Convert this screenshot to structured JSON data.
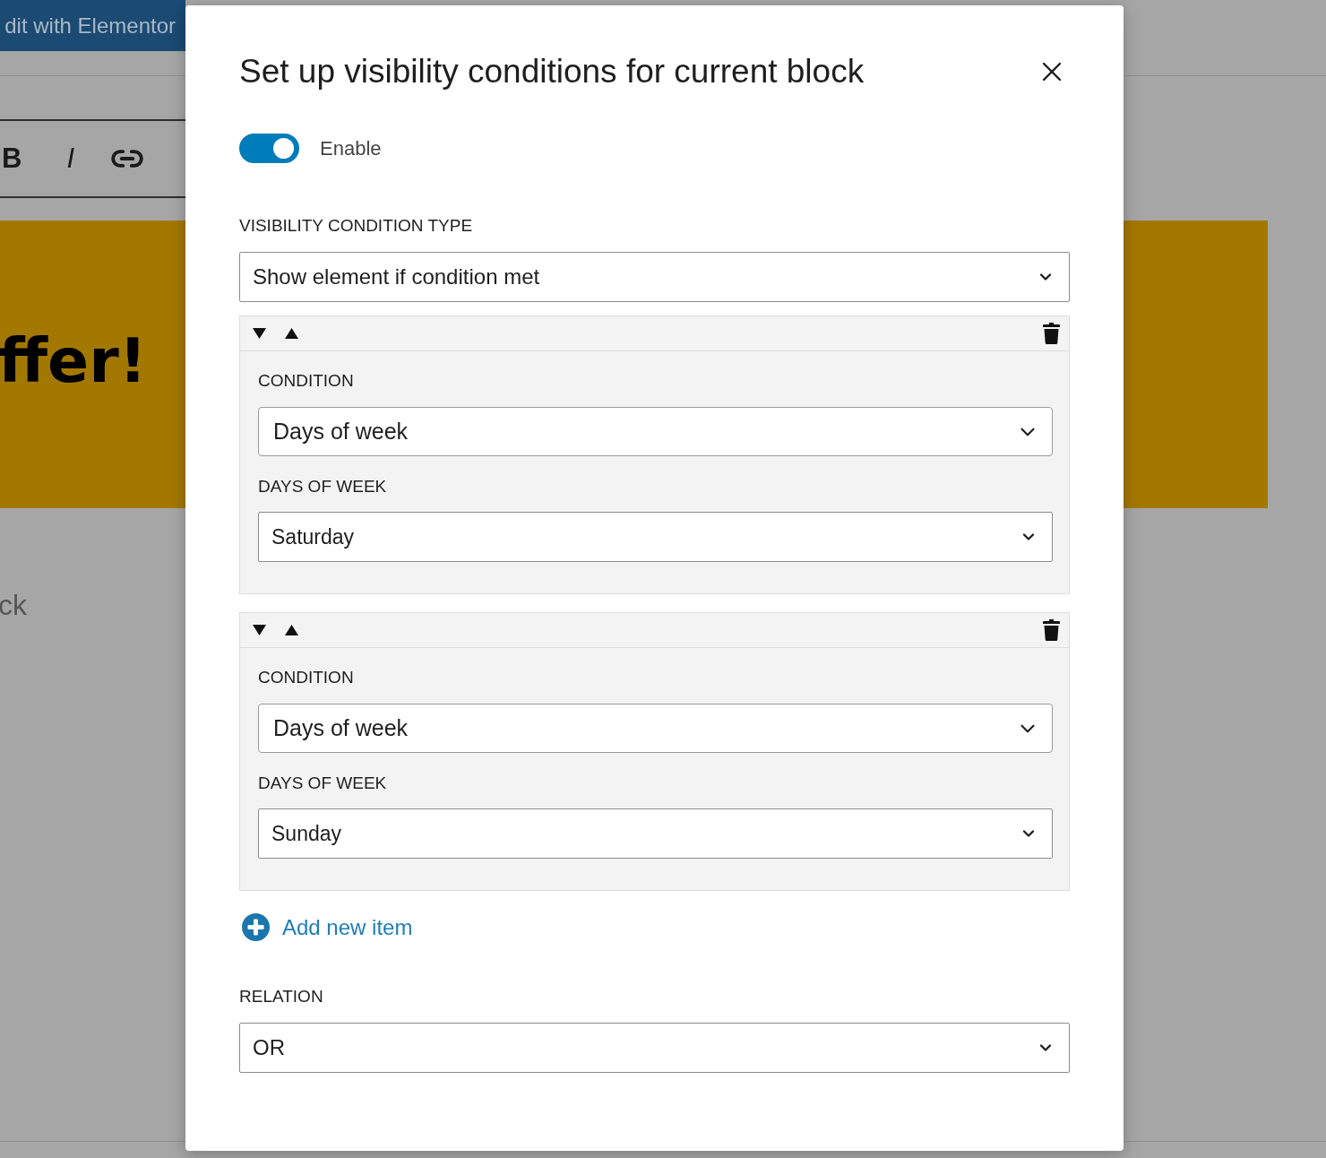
{
  "background": {
    "editor_button": "dit with Elementor",
    "format_buttons": [
      {
        "label": "B",
        "kind": "bold"
      },
      {
        "label": "I",
        "kind": "italic"
      }
    ],
    "banner": {
      "heading": "ffer!"
    },
    "paragraph": "ck"
  },
  "modal": {
    "title": "Set up visibility conditions for current block",
    "enable_toggle": {
      "label": "Enable",
      "on": true
    },
    "condition_type": {
      "label": "VISIBILITY CONDITION TYPE",
      "value": "Show element if condition met"
    },
    "conditions": [
      {
        "condition_label": "CONDITION",
        "condition_value": "Days of week",
        "days_label": "DAYS OF WEEK",
        "days_value": "Saturday"
      },
      {
        "condition_label": "CONDITION",
        "condition_value": "Days of week",
        "days_label": "DAYS OF WEEK",
        "days_value": "Sunday"
      }
    ],
    "add_item": "Add new item",
    "relation": {
      "label": "RELATION",
      "value": "OR"
    }
  }
}
